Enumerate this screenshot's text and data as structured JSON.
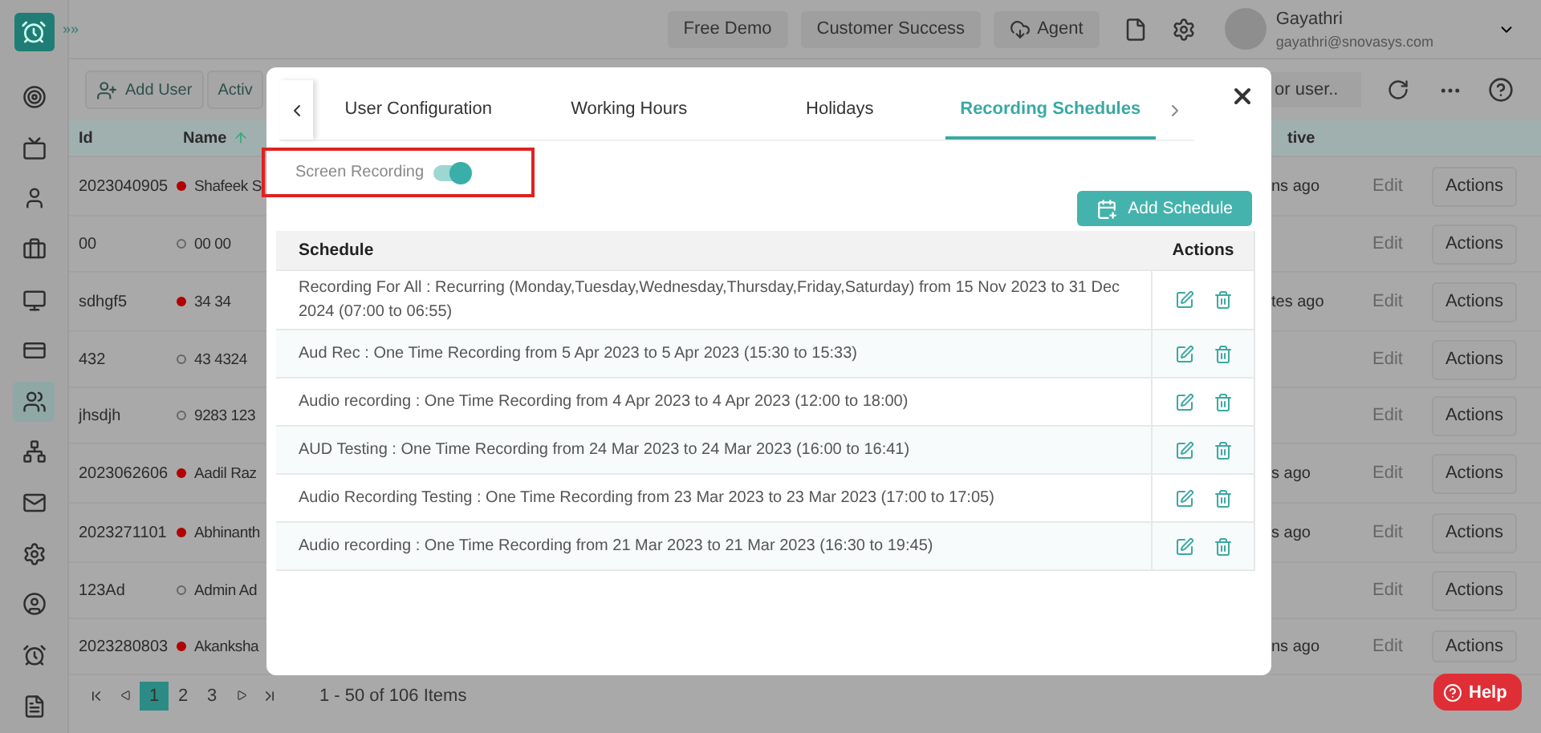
{
  "topbar": {
    "expand": "»»",
    "buttons": [
      {
        "label": "Free Demo",
        "kind": "plain"
      },
      {
        "label": "Customer Success",
        "kind": "plain"
      },
      {
        "label": "Agent",
        "kind": "cloud"
      }
    ],
    "user": {
      "name": "Gayathri",
      "email": "gayathri@snovasys.com"
    }
  },
  "sidebar": {
    "items": [
      {
        "selected": false
      },
      {
        "selected": false
      },
      {
        "selected": false
      },
      {
        "selected": false
      },
      {
        "selected": false
      },
      {
        "selected": false
      },
      {
        "selected": true
      },
      {
        "selected": false
      },
      {
        "selected": false
      },
      {
        "selected": false
      },
      {
        "selected": false
      },
      {
        "selected": false
      },
      {
        "selected": false
      }
    ]
  },
  "toolbar": {
    "add_user": "Add User",
    "filter": "Activ",
    "search_placeholder": "or user.."
  },
  "table": {
    "columns": {
      "id": "Id",
      "name": "Name",
      "column_3": "tive"
    },
    "rows": [
      {
        "id": "2023040905",
        "name": "Shafeek S",
        "online": true,
        "column_3": "ns ago",
        "edit": "Edit",
        "actions": "Actions"
      },
      {
        "id": "00",
        "name": "00 00",
        "online": false,
        "edit": "Edit",
        "actions": "Actions"
      },
      {
        "id": "sdhgf5",
        "name": "34 34",
        "online": true,
        "column_3": "tes ago",
        "edit": "Edit",
        "actions": "Actions"
      },
      {
        "id": "432",
        "name": "43 4324",
        "online": false,
        "edit": "Edit",
        "actions": "Actions"
      },
      {
        "id": "jhsdjh",
        "name": "9283 123",
        "online": false,
        "edit": "Edit",
        "actions": "Actions"
      },
      {
        "id": "2023062606",
        "name": "Aadil Raz",
        "online": true,
        "column_3": "s ago",
        "edit": "Edit",
        "actions": "Actions"
      },
      {
        "id": "2023271101",
        "name": "Abhinanth",
        "online": true,
        "column_3": "s ago",
        "edit": "Edit",
        "actions": "Actions"
      },
      {
        "id": "123Ad",
        "name": "Admin Ad",
        "online": false,
        "edit": "Edit",
        "actions": "Actions"
      },
      {
        "id": "2023280803",
        "name": "Akanksha",
        "online": true,
        "column_3": "ns ago",
        "edit": "Edit",
        "actions": "Actions"
      }
    ]
  },
  "pager": {
    "pages": [
      {
        "label": "1",
        "selected": true
      },
      {
        "label": "2",
        "selected": false
      },
      {
        "label": "3",
        "selected": false
      }
    ],
    "summary": "1 - 50 of 106 Items"
  },
  "modal": {
    "tabs": [
      {
        "label": "User Configuration",
        "selected": false
      },
      {
        "label": "Working Hours",
        "selected": false
      },
      {
        "label": "Holidays",
        "selected": false
      },
      {
        "label": "Recording Schedules",
        "selected": true
      }
    ],
    "screen_recording": {
      "label": "Screen Recording",
      "on": true,
      "highlighted": true
    },
    "add_schedule": "Add Schedule",
    "columns": [
      "Schedule",
      "Actions"
    ],
    "schedules": [
      "Recording For All : Recurring (Monday,Tuesday,Wednesday,Thursday,Friday,Saturday) from 15 Nov 2023 to 31 Dec 2024 (07:00 to 06:55)",
      "Aud Rec : One Time Recording from 5 Apr 2023 to 5 Apr 2023 (15:30 to 15:33)",
      "Audio recording : One Time Recording from 4 Apr 2023 to 4 Apr 2023 (12:00 to 18:00)",
      "AUD Testing : One Time Recording from 24 Mar 2023 to 24 Mar 2023 (16:00 to 16:41)",
      "Audio Recording Testing : One Time Recording from 23 Mar 2023 to 23 Mar 2023 (17:00 to 17:05)",
      "Audio recording : One Time Recording from 21 Mar 2023 to 21 Mar 2023 (16:30 to 19:45)"
    ]
  },
  "help": "Help"
}
